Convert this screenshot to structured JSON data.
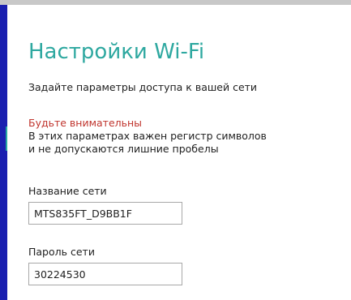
{
  "page": {
    "title": "Настройки Wi-Fi",
    "subtitle": "Задайте параметры доступа к вашей сети"
  },
  "warning": {
    "title": "Будьте внимательны",
    "line1": "В этих параметрах важен регистр символов",
    "line2": "и не допускаются лишние пробелы"
  },
  "fields": {
    "ssid": {
      "label": "Название сети",
      "value": "MTS835FT_D9BB1F"
    },
    "password": {
      "label": "Пароль сети",
      "value": "30224530"
    }
  },
  "colors": {
    "accent": "#2ea8a0",
    "warning": "#c0352e",
    "sidebar": "#1a1fb0"
  }
}
